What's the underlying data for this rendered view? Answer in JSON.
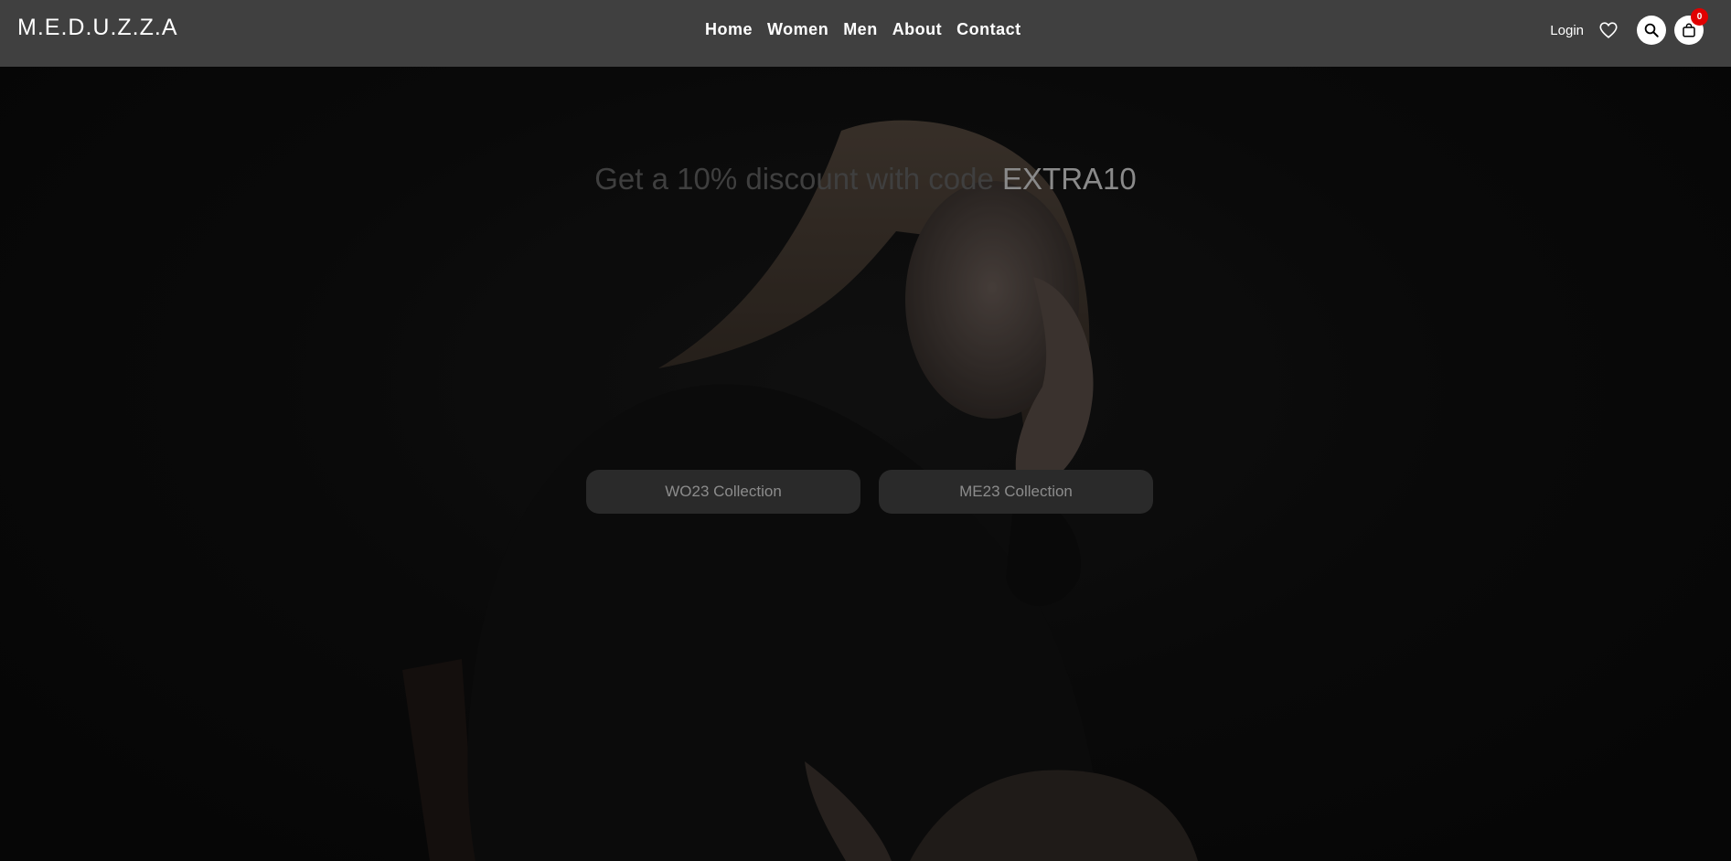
{
  "header": {
    "logo": "M.E.D.U.Z.Z.A",
    "nav": [
      {
        "label": "Home"
      },
      {
        "label": "Women"
      },
      {
        "label": "Men"
      },
      {
        "label": "About"
      },
      {
        "label": "Contact"
      }
    ],
    "login_label": "Login",
    "wishlist_icon": "heart-icon",
    "search_icon": "search-icon",
    "cart_icon": "shopping-bag-icon",
    "cart_count": "0"
  },
  "hero": {
    "promo_text": "Get a 10% discount with code ",
    "promo_code": "EXTRA10",
    "buttons": [
      {
        "label": "WO23 Collection"
      },
      {
        "label": "ME23 Collection"
      }
    ]
  },
  "colors": {
    "header_bg": "#404040",
    "badge": "#e10000",
    "hero_bg": "#0b0b0b"
  }
}
